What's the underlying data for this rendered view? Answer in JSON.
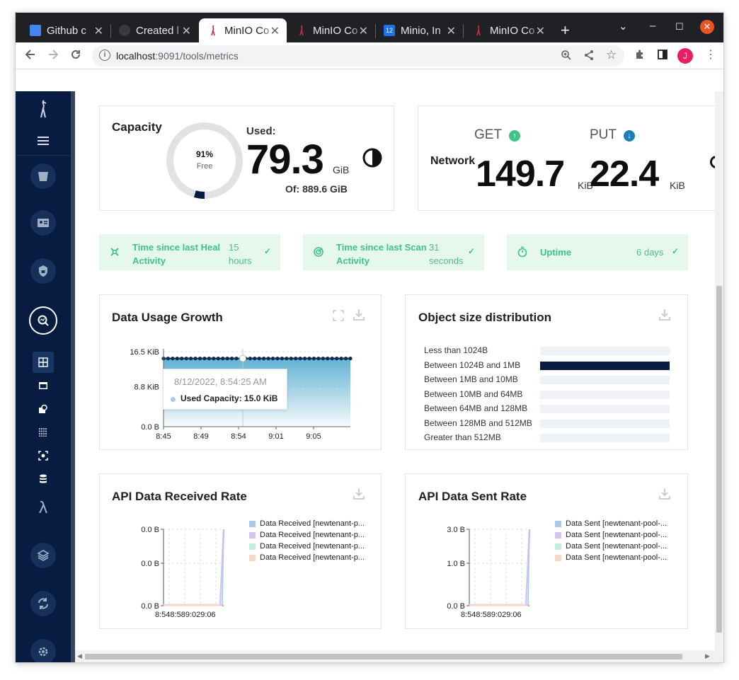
{
  "browser": {
    "tabs": [
      {
        "title": "Github c",
        "favicon": "doc-icon",
        "color": "#4285f4"
      },
      {
        "title": "Created l",
        "favicon": "github-icon",
        "color": "#2d2d2d"
      },
      {
        "title": "MinIO Co",
        "favicon": "minio-icon",
        "color": "#c72c48"
      },
      {
        "title": "MinIO Co",
        "favicon": "minio-icon",
        "color": "#c72c48"
      },
      {
        "title": "Minio, In",
        "favicon": "calendar-icon",
        "color": "#1a73e8"
      },
      {
        "title": "MinIO Co",
        "favicon": "minio-icon",
        "color": "#c72c48"
      }
    ],
    "active_tab": 2,
    "url_host": "localhost",
    "url_rest": ":9091/tools/metrics",
    "profile_initial": "J"
  },
  "capacity": {
    "title": "Capacity",
    "free_pct_label": "91%",
    "free_label": "Free",
    "free_fraction": 0.91,
    "used_label": "Used:",
    "used_value": "79.3",
    "used_unit": "GiB",
    "of_label": "Of: 889.6 GiB"
  },
  "network": {
    "title": "Network",
    "get_label": "GET",
    "put_label": "PUT",
    "get_value": "149.7",
    "get_unit": "KiB",
    "put_value": "22.4",
    "put_unit": "KiB"
  },
  "status": [
    {
      "label": "Time since last Heal Activity",
      "value": "15 hours",
      "icon": "heal-icon"
    },
    {
      "label": "Time since last Scan Activity",
      "value": "31 seconds",
      "icon": "scan-icon"
    },
    {
      "label": "Uptime",
      "value": "6 days",
      "icon": "timer-icon"
    }
  ],
  "usage_chart": {
    "title": "Data Usage Growth",
    "tooltip_time": "8/12/2022, 8:54:25 AM",
    "tooltip_value": "Used Capacity: 15.0 KiB"
  },
  "object_dist": {
    "title": "Object size distribution",
    "bars": [
      {
        "label": "Less than 1024B",
        "value": 0
      },
      {
        "label": "Between 1024B and 1MB",
        "value": 1
      },
      {
        "label": "Between 1MB and 10MB",
        "value": 0
      },
      {
        "label": "Between 10MB and 64MB",
        "value": 0
      },
      {
        "label": "Between 64MB and 128MB",
        "value": 0
      },
      {
        "label": "Between 128MB and 512MB",
        "value": 0
      },
      {
        "label": "Greater than 512MB",
        "value": 0
      }
    ]
  },
  "api_received": {
    "title": "API Data Received Rate",
    "legend": [
      "Data Received [newtenant-p...",
      "Data Received [newtenant-p...",
      "Data Received [newtenant-p...",
      "Data Received [newtenant-p..."
    ],
    "x_ticks_label": "8:548:589:029:06"
  },
  "api_sent": {
    "title": "API Data Sent Rate",
    "legend": [
      "Data Sent [newtenant-pool-...",
      "Data Sent [newtenant-pool-...",
      "Data Sent [newtenant-pool-...",
      "Data Sent [newtenant-pool-..."
    ],
    "x_ticks_label": "8:548:589:029:06"
  },
  "colors": {
    "sidebar": "#081c42",
    "accent_green": "#3ec28a",
    "status_bg": "#e6f7ee",
    "series": [
      "#a8c8e8",
      "#d3c5ec",
      "#c5ecdd",
      "#f3d8c8"
    ],
    "area_fill": "#5aaed1"
  },
  "chart_data": [
    {
      "type": "area",
      "title": "Data Usage Growth",
      "x": [
        "8:45",
        "8:49",
        "8:54",
        "9:01",
        "9:05"
      ],
      "y_ticks": [
        "0.0 B",
        "8.8 KiB",
        "16.5 KiB"
      ],
      "ylim": [
        0,
        16.5
      ],
      "y_unit": "KiB",
      "series": [
        {
          "name": "Used Capacity",
          "values": [
            15.0,
            15.0,
            15.0,
            15.0,
            15.0
          ]
        }
      ]
    },
    {
      "type": "bar",
      "title": "Object size distribution",
      "categories": [
        "Less than 1024B",
        "Between 1024B and 1MB",
        "Between 1MB and 10MB",
        "Between 10MB and 64MB",
        "Between 64MB and 128MB",
        "Between 128MB and 512MB",
        "Greater than 512MB"
      ],
      "values": [
        0,
        1,
        0,
        0,
        0,
        0,
        0
      ]
    },
    {
      "type": "line",
      "title": "API Data Received Rate",
      "x": [
        "8:54",
        "8:58",
        "9:02",
        "9:06"
      ],
      "y_ticks": [
        "0.0 B",
        "0.0 B",
        "0.0 B"
      ],
      "series": [
        {
          "name": "Data Received [newtenant-p...",
          "values": [
            0,
            0,
            0,
            0
          ]
        },
        {
          "name": "Data Received [newtenant-p...",
          "values": [
            0,
            0,
            0,
            0
          ]
        },
        {
          "name": "Data Received [newtenant-p...",
          "values": [
            0,
            0,
            0,
            0
          ]
        },
        {
          "name": "Data Received [newtenant-p...",
          "values": [
            0,
            0,
            0,
            0
          ]
        }
      ]
    },
    {
      "type": "line",
      "title": "API Data Sent Rate",
      "x": [
        "8:54",
        "8:58",
        "9:02",
        "9:06"
      ],
      "y_ticks": [
        "0.0 B",
        "1.0 B",
        "3.0 B"
      ],
      "series": [
        {
          "name": "Data Sent [newtenant-pool-...",
          "values": [
            0,
            0,
            0,
            0
          ]
        },
        {
          "name": "Data Sent [newtenant-pool-...",
          "values": [
            0,
            0,
            0,
            0
          ]
        },
        {
          "name": "Data Sent [newtenant-pool-...",
          "values": [
            0,
            0,
            0,
            0
          ]
        },
        {
          "name": "Data Sent [newtenant-pool-...",
          "values": [
            0,
            0,
            0,
            0
          ]
        }
      ]
    }
  ]
}
